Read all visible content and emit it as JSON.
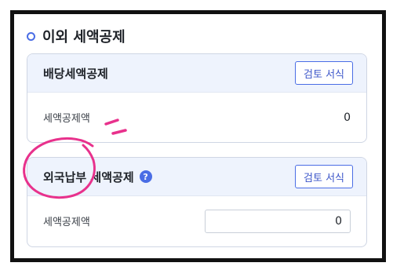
{
  "section": {
    "title": "이외 세액공제"
  },
  "dividend_credit": {
    "title": "배당세액공제",
    "review_button": "검토 서식",
    "amount_label": "세액공제액",
    "amount_value": "0"
  },
  "foreign_tax_credit": {
    "title": "외국납부 세액공제",
    "help_icon": "?",
    "review_button": "검토 서식",
    "amount_label": "세액공제액",
    "amount_value": "0"
  },
  "colors": {
    "accent": "#4a6de5",
    "card_header_bg": "#eef3fd",
    "annotation": "#e8318c",
    "frame": "#111111"
  }
}
